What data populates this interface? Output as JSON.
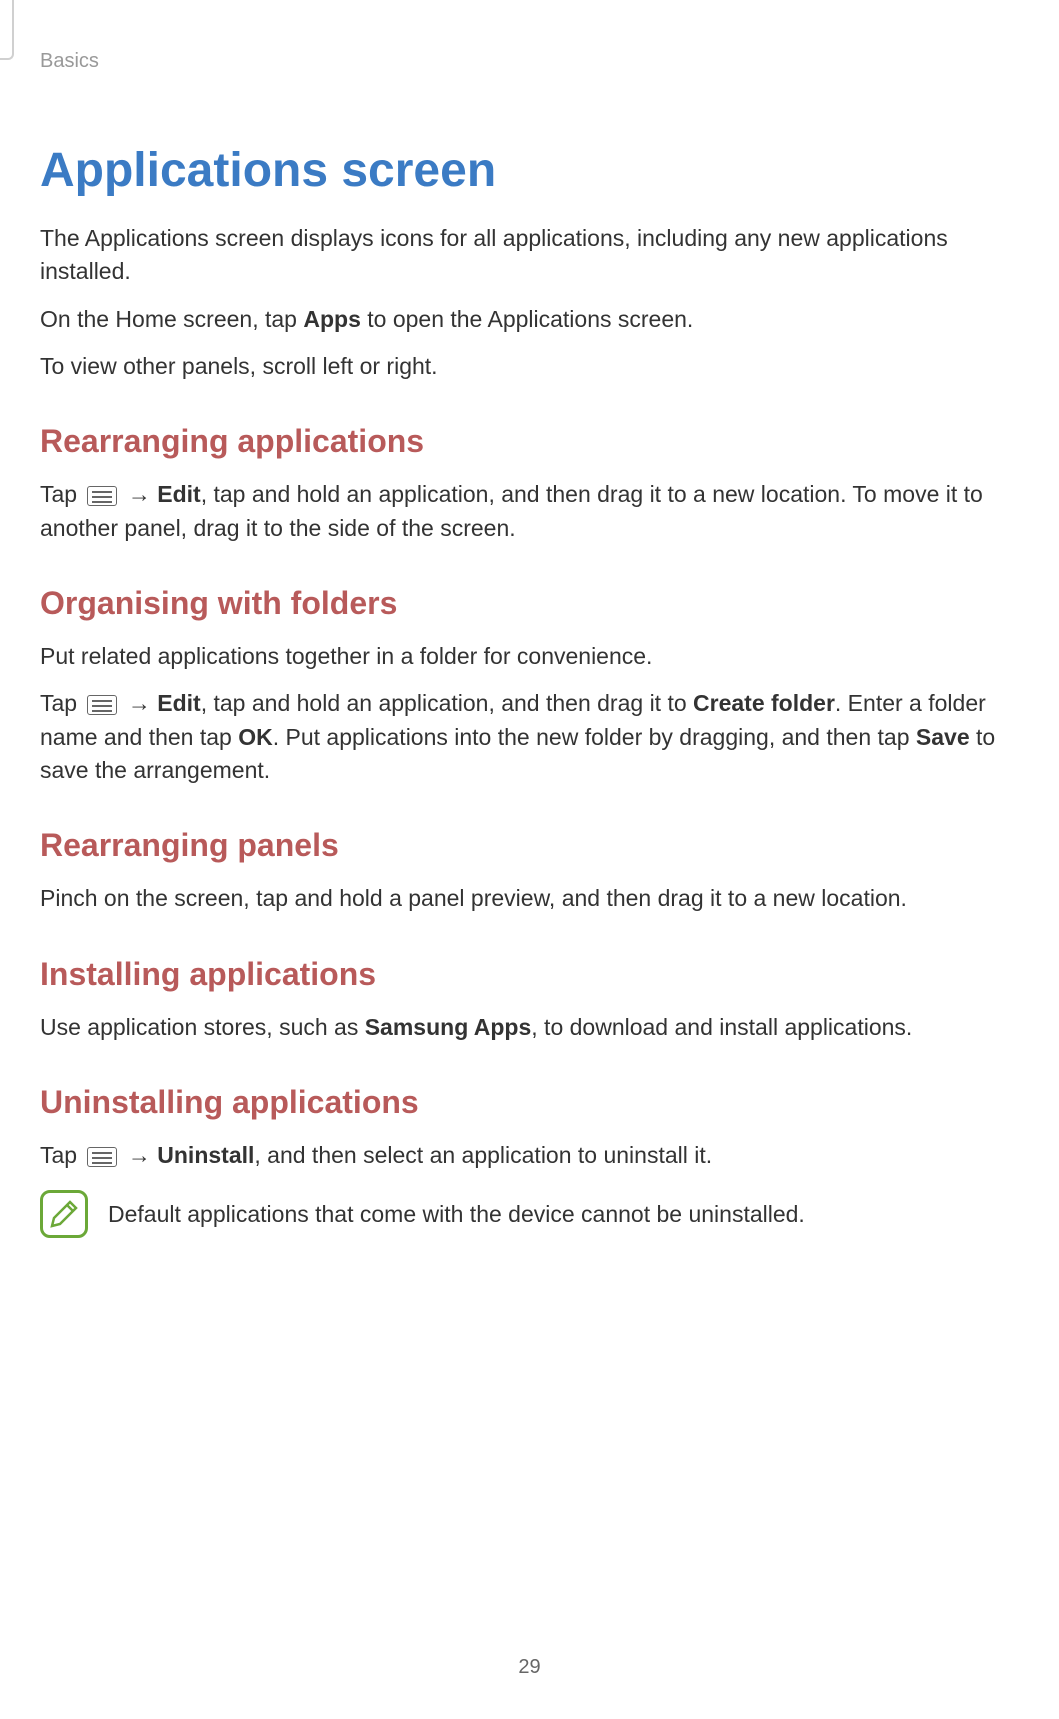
{
  "breadcrumb": "Basics",
  "main_title": "Applications screen",
  "intro": {
    "p1": "The Applications screen displays icons for all applications, including any new applications installed.",
    "p2_before": "On the Home screen, tap ",
    "p2_bold": "Apps",
    "p2_after": " to open the Applications screen.",
    "p3": "To view other panels, scroll left or right."
  },
  "sections": {
    "rearranging_apps": {
      "heading": "Rearranging applications",
      "p1_before": "Tap ",
      "p1_arrow": " → ",
      "p1_bold1": "Edit",
      "p1_after": ", tap and hold an application, and then drag it to a new location. To move it to another panel, drag it to the side of the screen."
    },
    "organising_folders": {
      "heading": "Organising with folders",
      "p1": "Put related applications together in a folder for convenience.",
      "p2_before": "Tap ",
      "p2_arrow": " → ",
      "p2_bold1": "Edit",
      "p2_mid1": ", tap and hold an application, and then drag it to ",
      "p2_bold2": "Create folder",
      "p2_mid2": ". Enter a folder name and then tap ",
      "p2_bold3": "OK",
      "p2_mid3": ". Put applications into the new folder by dragging, and then tap ",
      "p2_bold4": "Save",
      "p2_after": " to save the arrangement."
    },
    "rearranging_panels": {
      "heading": "Rearranging panels",
      "p1": "Pinch on the screen, tap and hold a panel preview, and then drag it to a new location."
    },
    "installing_apps": {
      "heading": "Installing applications",
      "p1_before": "Use application stores, such as ",
      "p1_bold": "Samsung Apps",
      "p1_after": ", to download and install applications."
    },
    "uninstalling_apps": {
      "heading": "Uninstalling applications",
      "p1_before": "Tap ",
      "p1_arrow": " → ",
      "p1_bold1": "Uninstall",
      "p1_after": ", and then select an application to uninstall it.",
      "note": "Default applications that come with the device cannot be uninstalled."
    }
  },
  "page_number": "29"
}
